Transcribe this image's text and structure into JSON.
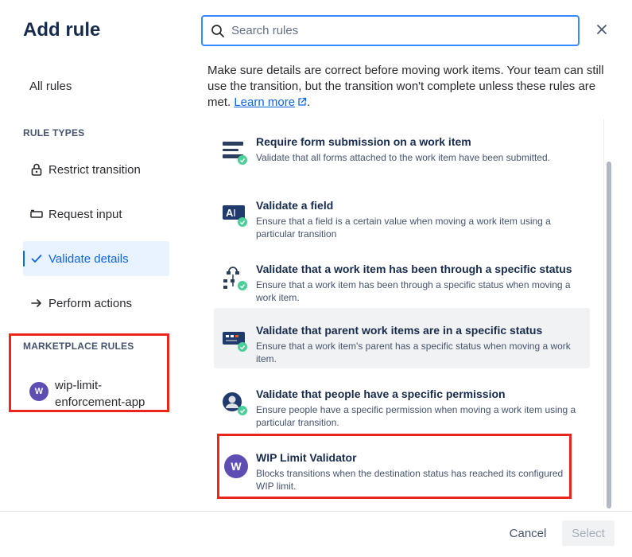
{
  "dialog": {
    "title": "Add rule",
    "close_icon": "close-icon"
  },
  "sidebar": {
    "all_rules": "All rules",
    "rule_types_heading": "RULE TYPES",
    "items": [
      {
        "label": "Restrict transition",
        "icon": "lock-icon"
      },
      {
        "label": "Request input",
        "icon": "input-box-icon"
      },
      {
        "label": "Validate details",
        "icon": "checkmark-icon",
        "selected": true
      },
      {
        "label": "Perform actions",
        "icon": "arrow-right-icon"
      }
    ],
    "marketplace_heading": "MARKETPLACE RULES",
    "marketplace_items": [
      {
        "label": "wip-limit-enforcement-app",
        "avatar": "W"
      }
    ]
  },
  "search": {
    "placeholder": "Search rules",
    "value": ""
  },
  "description": {
    "text": "Make sure details are correct before moving work items. Your team can still use the transition, but the transition won't complete unless these rules are met. ",
    "link": "Learn more",
    "suffix": "."
  },
  "rules": [
    {
      "title": "Require form submission on a work item",
      "desc": "Validate that all forms attached to the work item have been submitted.",
      "icon": "form-icon"
    },
    {
      "title": "Validate a field",
      "desc": "Ensure that a field is a certain value when moving a work item using a particular transition",
      "icon": "field-icon"
    },
    {
      "title": "Validate that a work item has been through a specific status",
      "desc": "Ensure that a work item has been through a specific status when moving a work item.",
      "icon": "status-flow-icon"
    },
    {
      "title": "Validate that parent work items are in a specific status",
      "desc": "Ensure that a work item's parent has a specific status when moving a work item.",
      "icon": "parent-status-icon"
    },
    {
      "title": "Validate that people have a specific permission",
      "desc": "Ensure people have a specific permission when moving a work item using a particular transition.",
      "icon": "person-permission-icon"
    },
    {
      "title": "WIP Limit Validator",
      "desc": "Blocks transitions when the destination status has reached its configured WIP limit.",
      "icon": "wip-avatar",
      "avatar": "W"
    }
  ],
  "footer": {
    "cancel": "Cancel",
    "select": "Select"
  },
  "colors": {
    "accent": "#0c66e4",
    "highlight_border": "#e8261c",
    "avatar": "#5e4db2"
  }
}
